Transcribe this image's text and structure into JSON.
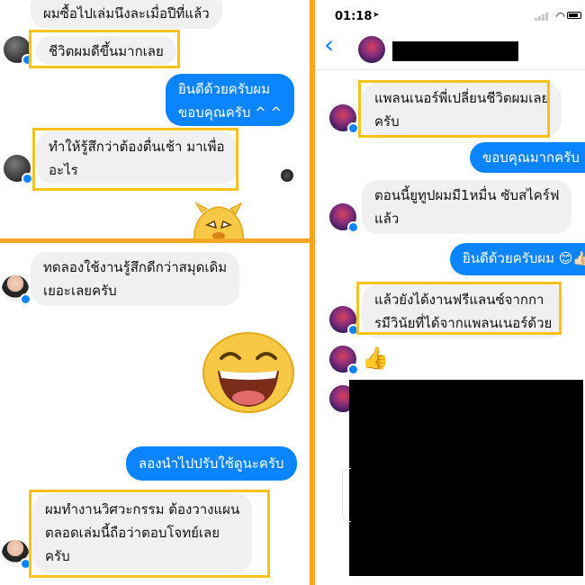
{
  "colors": {
    "divider": "#f5a623",
    "highlight": "#f8c21c",
    "bubble_out": "#0a84ff",
    "bubble_in": "#f0f0f0",
    "emoji_yellow": "#f7c843"
  },
  "panel_top_left": {
    "messages": [
      {
        "direction": "in",
        "lines": [
          "ผมซื้อไปเล่มนึงละเมื่อปีที่แล้ว"
        ]
      },
      {
        "direction": "in",
        "lines": [
          "ชีวิตผมดีขึ้นมากเลย"
        ],
        "highlighted": true
      },
      {
        "direction": "out",
        "lines": [
          "ยินดีด้วยครับผม",
          "ขอบคุณครับ ^ ^"
        ]
      },
      {
        "direction": "in",
        "lines": [
          "ทำให้รู้สึกว่าต้องตื่นเช้า มาเพื่อ",
          "อะไร"
        ],
        "highlighted": true
      }
    ],
    "sticker_icon": "yellow-blob-sticker-icon"
  },
  "panel_bottom_left": {
    "messages": [
      {
        "direction": "in",
        "lines": [
          "ทดลองใช้งานรู้สึกดีกว่าสมุดเดิม",
          "เยอะเลยครับ"
        ]
      },
      {
        "direction": "out",
        "lines": [
          "ลองนำไปปรับใช้ดูนะครับ"
        ]
      },
      {
        "direction": "in",
        "lines": [
          "ผมทำงานวิศวะกรรม ต้องวางแผน",
          "ตลอดเล่มนี้ถือว่าตอบโจทย์เลย",
          "ครับ"
        ],
        "highlighted": true
      }
    ],
    "emoji_icon": "laughing-face-emoji-icon"
  },
  "panel_right": {
    "status_bar": {
      "time": "01:18",
      "location_icon": "location-arrow-icon",
      "signal_icon": "signal-icon",
      "wifi_icon": "wifi-icon",
      "battery_icon": "battery-icon"
    },
    "nav": {
      "back_icon": "chevron-left-icon",
      "back_glyph": "‹"
    },
    "messages": [
      {
        "direction": "in",
        "lines": [
          "แพลนเนอร์พี่เปลี่ยนชีวิตผมเลย",
          "ครับ"
        ],
        "highlighted": true
      },
      {
        "direction": "out",
        "lines": [
          "ขอบคุณมากครับ 🙏🏻"
        ]
      },
      {
        "direction": "in",
        "lines": [
          "ตอนนี้ยูทูปผมมี1หมื่น ซับสไคร์ฟ",
          "แล้ว"
        ]
      },
      {
        "direction": "out",
        "lines": [
          "ยินดีด้วยครับผม 😊👍🏻"
        ]
      },
      {
        "direction": "in",
        "lines": [
          "แล้วยังได้งานฟรีแลนซ์จากกา",
          "รมีวินัยที่ได้จากแพลนเนอร์ด้วย"
        ],
        "highlighted": true
      }
    ],
    "like_glyph": "👍",
    "like_icon": "thumbs-up-icon"
  }
}
